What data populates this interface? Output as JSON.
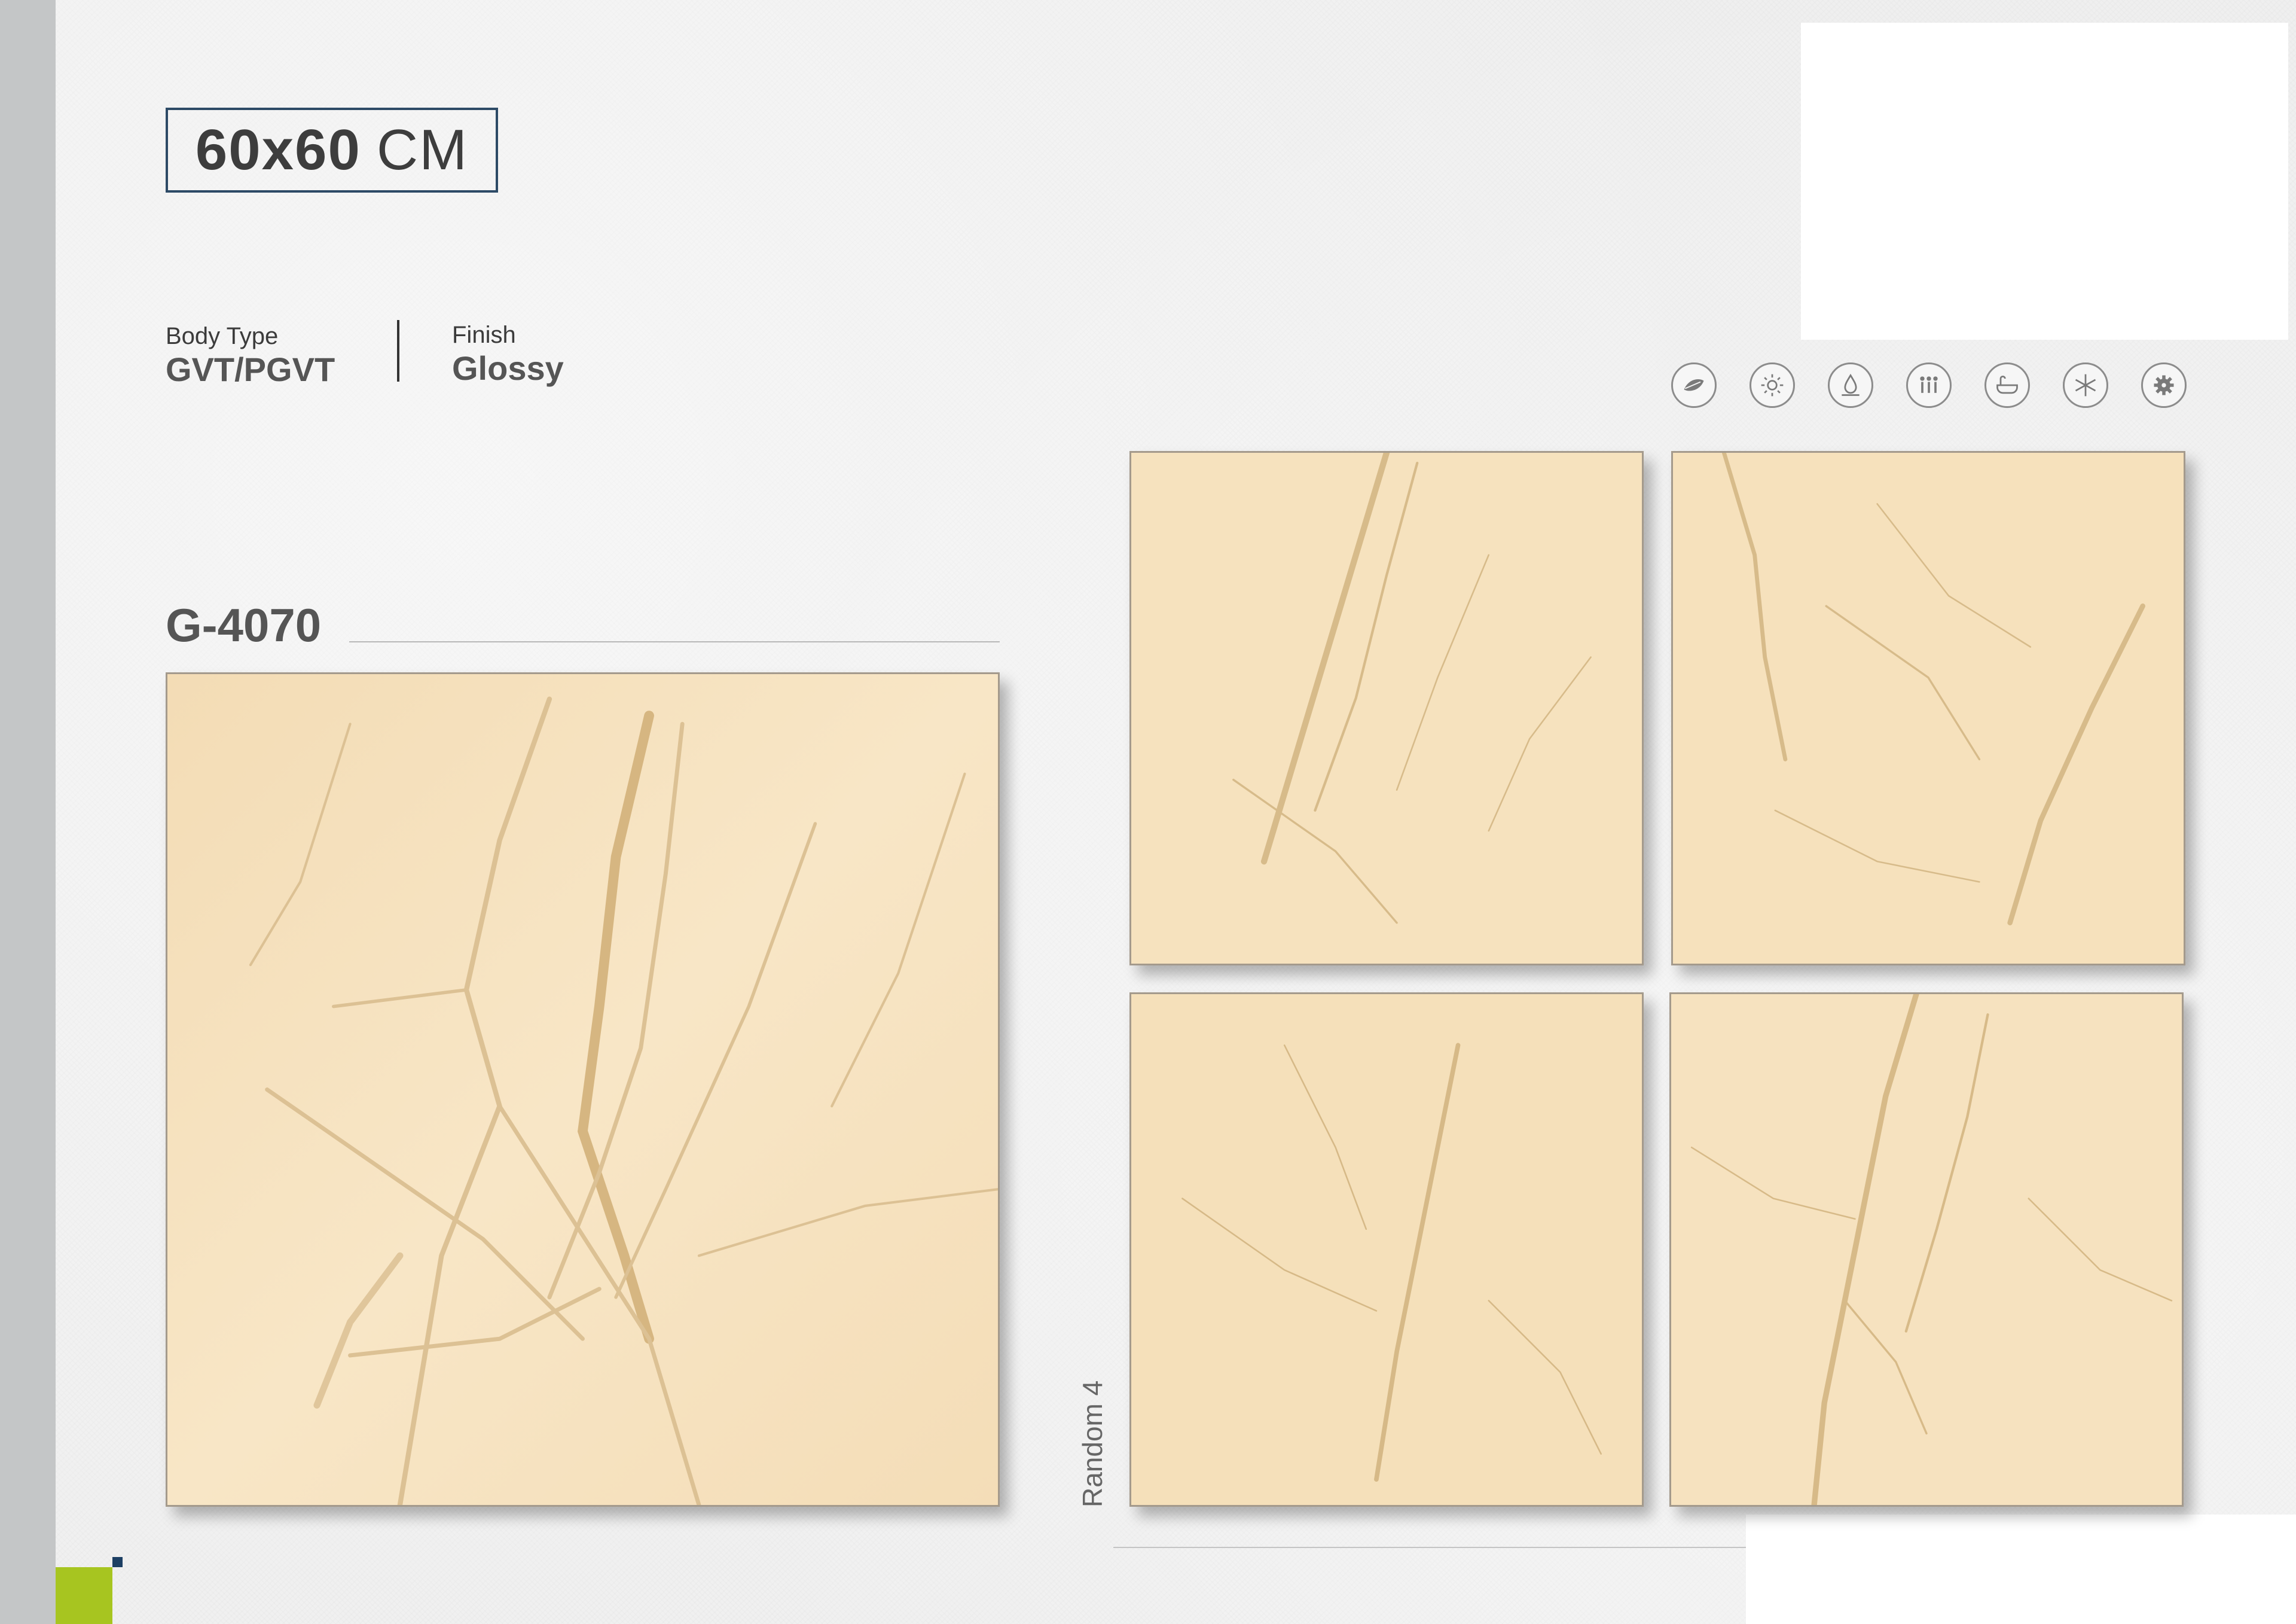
{
  "size": {
    "number": "60x60",
    "unit": "CM"
  },
  "specs": {
    "body_type": {
      "label": "Body Type",
      "value": "GVT/PGVT"
    },
    "finish": {
      "label": "Finish",
      "value": "Glossy"
    }
  },
  "product": {
    "code": "G-4070"
  },
  "variants": {
    "label": "Random 4"
  },
  "feature_icons": [
    "leaf-icon",
    "sun-icon",
    "stain-resistant-icon",
    "high-traffic-icon",
    "bathtub-icon",
    "frost-resistant-icon",
    "gear-icon"
  ],
  "colors": {
    "frame": "#2d4a66",
    "accent_green": "#a7c520",
    "accent_navy": "#1c3f63",
    "tile_base": "#f7e2bd",
    "tile_vein": "#d9bd8c"
  }
}
